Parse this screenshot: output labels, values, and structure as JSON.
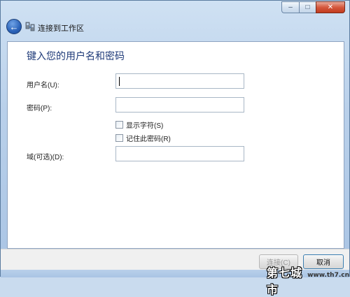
{
  "window": {
    "title": "连接到工作区",
    "caption_buttons": {
      "minimize": "‒",
      "maximize": "□",
      "close": "✕"
    }
  },
  "form": {
    "heading": "键入您的用户名和密码",
    "username_label": "用户名(U):",
    "username_value": "",
    "password_label": "密码(P):",
    "password_value": "",
    "show_chars_label": "显示字符(S)",
    "show_chars_checked": false,
    "remember_label": "记住此密码(R)",
    "remember_checked": false,
    "domain_label": "域(可选)(D):",
    "domain_value": ""
  },
  "footer": {
    "connect_label": "连接(C)",
    "connect_enabled": false,
    "cancel_label": "取消"
  },
  "watermark": {
    "logo": "第七城市",
    "url": "www.th7.cn"
  },
  "colors": {
    "heading": "#1e3a78",
    "chrome": "#b9d0ea",
    "close": "#c13b1f"
  }
}
